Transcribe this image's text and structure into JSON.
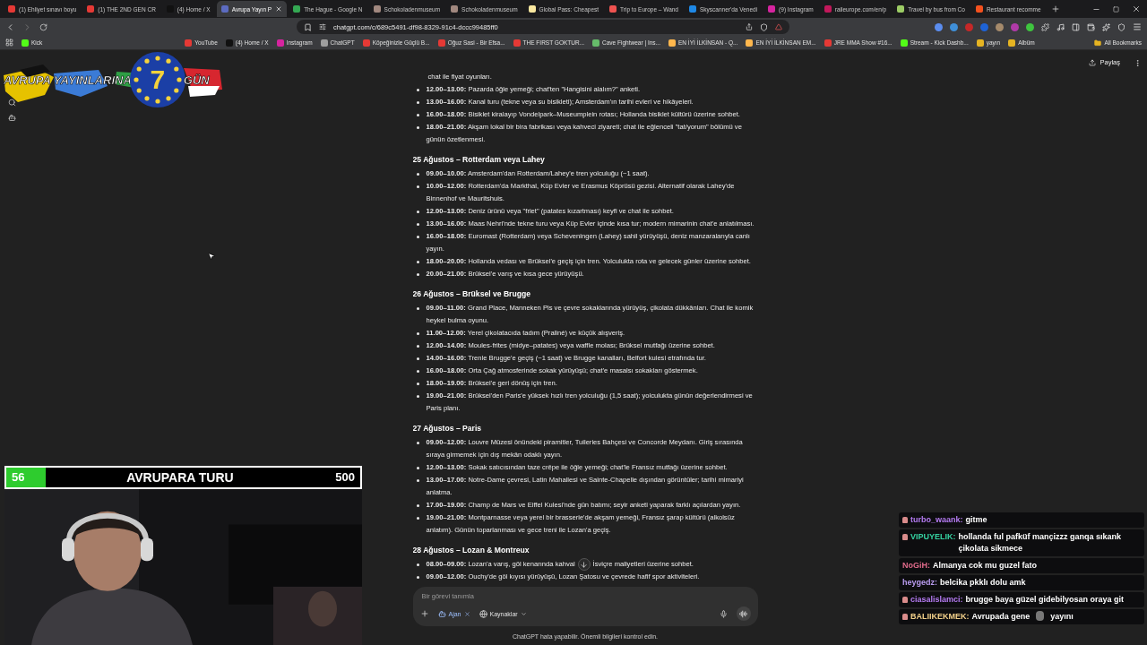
{
  "browser": {
    "tabs": [
      {
        "title": "(1) Ehliyet sınavı boyu",
        "color": "#e53935",
        "selected": false
      },
      {
        "title": "(1) THE 2ND GEN CR",
        "color": "#e53935",
        "selected": false
      },
      {
        "title": "(4) Home / X",
        "color": "#111111",
        "selected": false
      },
      {
        "title": "Avrupa Yayın P",
        "color": "#5c6bc0",
        "selected": true
      },
      {
        "title": "The Hague - Google N",
        "color": "#34a853",
        "selected": false
      },
      {
        "title": "Schokoladenmuseum",
        "color": "#a1887f",
        "selected": false
      },
      {
        "title": "Schokoladenmuseum",
        "color": "#a1887f",
        "selected": false
      },
      {
        "title": "Global Pass: Cheapest",
        "color": "#f9e79f",
        "selected": false
      },
      {
        "title": "Trip to Europe – Wand",
        "color": "#ef5350",
        "selected": false
      },
      {
        "title": "Skyscanner'da Venedi",
        "color": "#1e88e5",
        "selected": false
      },
      {
        "title": "(9) Instagram",
        "color": "#d6249f",
        "selected": false
      },
      {
        "title": "raileurope.com/en/p",
        "color": "#c2185b",
        "selected": false
      },
      {
        "title": "Travel by bus from Co",
        "color": "#9ccc65",
        "selected": false
      },
      {
        "title": "Restaurant recomme",
        "color": "#f4511e",
        "selected": false
      }
    ],
    "address": "chatgpt.com/c/689c5491-df98-8329-91c4-dccc99485ff0",
    "bookmarks": [
      {
        "title": "Kick",
        "color": "#53fc18"
      },
      {
        "title": "YouTube",
        "color": "#e53935"
      },
      {
        "title": "(4) Home / X",
        "color": "#111111"
      },
      {
        "title": "Instagram",
        "color": "#d6249f"
      },
      {
        "title": "ChatGPT",
        "color": "#9e9e9e"
      },
      {
        "title": "Köpeğinizle Güçlü B...",
        "color": "#e53935"
      },
      {
        "title": "Oğuz Sasi - Bir Efsa...",
        "color": "#e53935"
      },
      {
        "title": "THE FIRST GOKTUR...",
        "color": "#e53935"
      },
      {
        "title": "Cave Fightwear | Ins...",
        "color": "#66bb6a"
      },
      {
        "title": "EN İYİ İLKİNSAN - Q...",
        "color": "#ffb74d"
      },
      {
        "title": "EN İYİ İLKİNSAN EM...",
        "color": "#ffb74d"
      },
      {
        "title": "JRE MMA Show #16...",
        "color": "#e53935"
      },
      {
        "title": "Stream - Kick Dashb...",
        "color": "#53fc18"
      },
      {
        "title": "yayın",
        "color": "#e6b422"
      },
      {
        "title": "Albüm",
        "color": "#e6b422"
      }
    ],
    "all_bookmarks": "All Bookmarks"
  },
  "chatgpt": {
    "share": "Paylaş",
    "lead_line": "chat ile fiyat oyunları.",
    "lead_items": [
      {
        "text": "**12.00–13.00:** Pazarda öğle yemeği; chat'ten \"Hangisini alalım?\" anketi."
      },
      {
        "text": "**13.00–16.00:** Kanal turu (tekne veya su bisikleti); Amsterdam'ın tarihi evleri ve hikâyeleri."
      },
      {
        "text": "**16.00–18.00:** Bisiklet kiralayıp Vondelpark–Museumplein rotası; Hollanda bisiklet kültürü üzerine sohbet."
      },
      {
        "text": "**18.00–21.00:** Akşam lokal bir bira fabrikası veya kahveci ziyareti; chat ile eğlenceli \"tat/yorum\" bölümü ve günün özetlenmesi."
      }
    ],
    "days": [
      {
        "heading": "25 Ağustos – Rotterdam veya Lahey",
        "items": [
          {
            "text": "**09.00–10.00:** Amsterdam'dan Rotterdam/Lahey'e tren yolculuğu (~1 saat)."
          },
          {
            "text": "**10.00–12.00:** Rotterdam'da Markthal, Küp Evler ve Erasmus Köprüsü gezisi. Alternatif olarak Lahey'de Binnenhof ve Mauritshuis."
          },
          {
            "text": "**12.00–13.00:** Deniz ürünü veya \"friet\" (patates kızartması) keyfi ve chat ile sohbet."
          },
          {
            "text": "**13.00–16.00:** Maas Nehri'nde tekne turu veya Küp Evler içinde kısa tur; modern mimarinin chat'e anlatılması."
          },
          {
            "text": "**16.00–18.00:** Euromast (Rotterdam) veya Scheveningen (Lahey) sahil yürüyüşü, deniz manzaralarıyla canlı yayın."
          },
          {
            "text": "**18.00–20.00:** Hollanda vedası ve Brüksel'e geçiş için tren. Yolculukta rota ve gelecek günler üzerine sohbet."
          },
          {
            "text": "**20.00–21.00:** Brüksel'e varış ve kısa gece yürüyüşü."
          }
        ]
      },
      {
        "heading": "26 Ağustos – Brüksel ve Brugge",
        "items": [
          {
            "text": "**09.00–11.00:** Grand Place, Manneken Pis ve çevre sokaklarında yürüyüş, çikolata dükkânları. Chat ile komik heykel bulma oyunu."
          },
          {
            "text": "**11.00–12.00:** Yerel çikolatacıda tadım (Praliné) ve küçük alışveriş."
          },
          {
            "text": "**12.00–14.00:** Moules-frites (midye–patates) veya waffle molası; Brüksel mutfağı üzerine sohbet."
          },
          {
            "text": "**14.00–16.00:** Trenle Brugge'e geçiş (~1 saat) ve Brugge kanalları, Belfort kulesi etrafında tur."
          },
          {
            "text": "**16.00–18.00:** Orta Çağ atmosferinde sokak yürüyüşü; chat'e masalsı sokakları göstermek."
          },
          {
            "text": "**18.00–19.00:** Brüksel'e geri dönüş için tren."
          },
          {
            "text": "**19.00–21.00:** Brüksel'den Paris'e yüksek hızlı tren yolculuğu (1,5 saat); yolculukta günün değerlendirmesi ve Paris planı."
          }
        ]
      },
      {
        "heading": "27 Ağustos – Paris",
        "items": [
          {
            "text": "**09.00–12.00:** Louvre Müzesi önündeki piramitler, Tuileries Bahçesi ve Concorde Meydanı. Giriş sırasında sıraya girmemek için dış mekân odaklı yayın."
          },
          {
            "text": "**12.00–13.00:** Sokak satıcısından taze crêpe ile öğle yemeği; chat'le Fransız mutfağı üzerine sohbet."
          },
          {
            "text": "**13.00–17.00:** Notre-Dame çevresi, Latin Mahallesi ve Sainte-Chapelle dışından görüntüler; tarihi mimariyi anlatma."
          },
          {
            "text": "**17.00–19.00:** Champ de Mars ve Eiffel Kulesi'nde gün batımı; seyir anketi yaparak farklı açılardan yayın."
          },
          {
            "text": "**19.00–21.00:** Montparnasse veya yerel bir brasserie'de akşam yemeği, Fransız şarap kültürü (alkolsüz anlatım). Günün toparlanması ve gece treni ile Lozan'a geçiş."
          }
        ]
      },
      {
        "heading": "28 Ağustos – Lozan & Montreux",
        "items": [
          {
            "text": "**08.00–09.00:** Lozan'a varış, göl kenarında kahval",
            "text_after": "İsviçre maliyetleri üzerine sohbet."
          },
          {
            "text": "**09.00–12.00:** Ouchy'de göl kıyısı yürüyüşü, Lozan Şatosu ve çevrede hafif spor aktiviteleri."
          }
        ]
      }
    ],
    "composer": {
      "placeholder": "Bir görevi tanımla",
      "agent_chip": "Ajan",
      "sources": "Kaynaklar"
    },
    "disclaimer": "ChatGPT hata yapabilir. Önemli bilgileri kontrol edin."
  },
  "overlay": {
    "logo": {
      "left": "AVRUPA YAYINLARINA",
      "day": "7",
      "right": "GÜN"
    },
    "goal": {
      "current": "56",
      "title": "AVRUPARA TURU",
      "target": "500",
      "level": 0.112
    },
    "chat": [
      {
        "user": "turbo_waank:",
        "color": "#b57bf2",
        "badge": true,
        "text": "gitme"
      },
      {
        "user": "VIPUYELIK:",
        "color": "#35d0a0",
        "badge": true,
        "text": "hollanda ful pafküf mançizzz ganqa sıkank çikolata sikmece"
      },
      {
        "user": "NoGiH:",
        "color": "#e06b8b",
        "badge": false,
        "text": "Almanya cok mu guzel fato"
      },
      {
        "user": "heygedz:",
        "color": "#b99cf0",
        "badge": false,
        "text": "belcika pkklı dolu amk"
      },
      {
        "user": "ciasalislamci:",
        "color": "#b57bf2",
        "badge": true,
        "text": "brugge baya güzel gidebilyosan oraya git"
      },
      {
        "user": "BALIIKEKMEK:",
        "color": "#f2d08a",
        "badge": true,
        "text": "Avrupada gene",
        "emote": true,
        "text_after": "yayını"
      }
    ]
  }
}
